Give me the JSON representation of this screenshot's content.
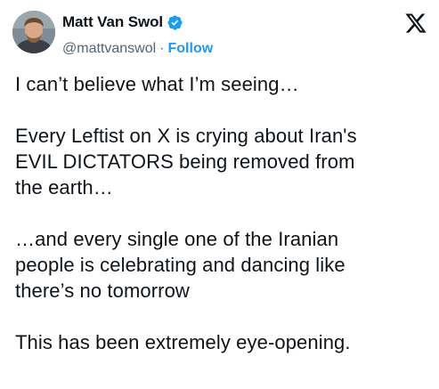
{
  "author": {
    "display_name": "Matt Van Swol",
    "handle": "@mattvanswol",
    "separator": "·",
    "follow_label": "Follow",
    "verified_color": "#1d9bf0",
    "avatar_icon": "profile-photo"
  },
  "brand": {
    "logo_icon": "x-logo-icon"
  },
  "tweet": {
    "lines": [
      "I can’t believe what I’m seeing…",
      "Every Leftist on X is crying about Iran's",
      "EVIL DICTATORS being removed from",
      "the earth…",
      "…and every single one of the Iranian",
      "people is celebrating and dancing like",
      "there’s no tomorrow",
      "This has been extremely eye-opening."
    ]
  }
}
